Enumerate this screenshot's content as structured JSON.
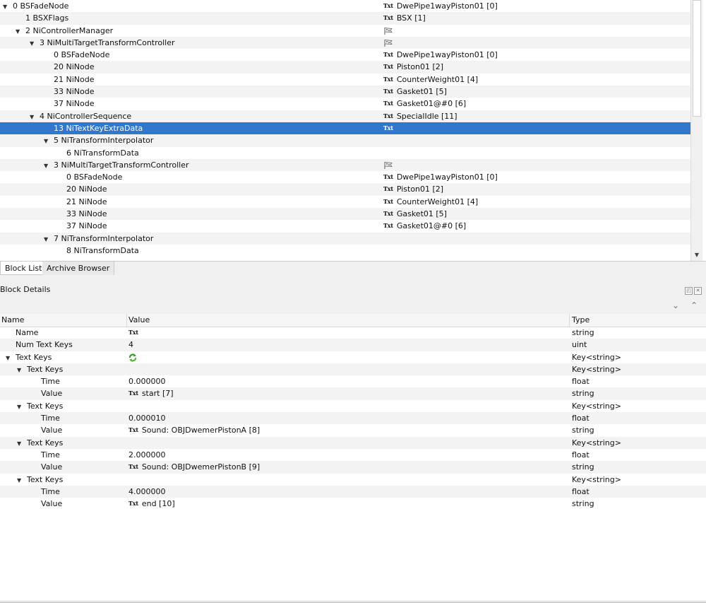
{
  "block_list": {
    "rows": [
      {
        "name": "0 BSFadeNode",
        "value": "DwePipe1wayPiston01 [0]",
        "value_icon": "txt",
        "expanded": true
      },
      {
        "name": "1 BSXFlags",
        "value": "BSX [1]",
        "value_icon": "txt"
      },
      {
        "name": "2 NiControllerManager",
        "value": "",
        "value_icon": "flag",
        "expanded": true
      },
      {
        "name": "3 NiMultiTargetTransformController",
        "value": "",
        "value_icon": "flag",
        "expanded": true
      },
      {
        "name": "0 BSFadeNode",
        "value": "DwePipe1wayPiston01 [0]",
        "value_icon": "txt"
      },
      {
        "name": "20 NiNode",
        "value": "Piston01 [2]",
        "value_icon": "txt"
      },
      {
        "name": "21 NiNode",
        "value": "CounterWeight01 [4]",
        "value_icon": "txt"
      },
      {
        "name": "33 NiNode",
        "value": "Gasket01 [5]",
        "value_icon": "txt"
      },
      {
        "name": "37 NiNode",
        "value": "Gasket01@#0 [6]",
        "value_icon": "txt"
      },
      {
        "name": "4 NiControllerSequence",
        "value": "SpecialIdle [11]",
        "value_icon": "txt",
        "expanded": true
      },
      {
        "name": "13 NiTextKeyExtraData",
        "value": "",
        "value_icon": "txt",
        "selected": true
      },
      {
        "name": "5 NiTransformInterpolator",
        "value": "",
        "value_icon": "",
        "expanded": true
      },
      {
        "name": "6 NiTransformData",
        "value": "",
        "value_icon": ""
      },
      {
        "name": "3 NiMultiTargetTransformController",
        "value": "",
        "value_icon": "flag",
        "expanded": true
      },
      {
        "name": "0 BSFadeNode",
        "value": "DwePipe1wayPiston01 [0]",
        "value_icon": "txt"
      },
      {
        "name": "20 NiNode",
        "value": "Piston01 [2]",
        "value_icon": "txt"
      },
      {
        "name": "21 NiNode",
        "value": "CounterWeight01 [4]",
        "value_icon": "txt"
      },
      {
        "name": "33 NiNode",
        "value": "Gasket01 [5]",
        "value_icon": "txt"
      },
      {
        "name": "37 NiNode",
        "value": "Gasket01@#0 [6]",
        "value_icon": "txt"
      },
      {
        "name": "7 NiTransformInterpolator",
        "value": "",
        "value_icon": "",
        "expanded": true
      },
      {
        "name": "8 NiTransformData",
        "value": "",
        "value_icon": ""
      }
    ],
    "expand_glyph": "▼",
    "scroll_down_glyph": "▼",
    "txt_badge": "Txt"
  },
  "tabs": [
    {
      "label": "Block List",
      "active": true
    },
    {
      "label": "Archive Browser",
      "active": false
    }
  ],
  "details": {
    "title": "Block Details",
    "dock_float_glyph": "◰",
    "dock_close_glyph": "✕",
    "expand_all_glyph": "⌄",
    "collapse_all_glyph": "⌃",
    "columns": {
      "name": "Name",
      "value": "Value",
      "type": "Type"
    },
    "rows": [
      {
        "name": "Name",
        "value": "",
        "value_icon": "txt",
        "type": "string"
      },
      {
        "name": "Num Text Keys",
        "value": "4",
        "value_icon": "",
        "type": "uint"
      },
      {
        "name": "Text Keys",
        "value": "",
        "value_icon": "refresh",
        "type": "Key<string>",
        "expanded": true
      },
      {
        "name": "Text Keys",
        "value": "",
        "value_icon": "",
        "type": "Key<string>",
        "expanded": true
      },
      {
        "name": "Time",
        "value": "0.000000",
        "value_icon": "",
        "type": "float"
      },
      {
        "name": "Value",
        "value": "start [7]",
        "value_icon": "txt",
        "type": "string"
      },
      {
        "name": "Text Keys",
        "value": "",
        "value_icon": "",
        "type": "Key<string>",
        "expanded": true
      },
      {
        "name": "Time",
        "value": "0.000010",
        "value_icon": "",
        "type": "float"
      },
      {
        "name": "Value",
        "value": "Sound: OBJDwemerPistonA [8]",
        "value_icon": "txt",
        "type": "string"
      },
      {
        "name": "Text Keys",
        "value": "",
        "value_icon": "",
        "type": "Key<string>",
        "expanded": true
      },
      {
        "name": "Time",
        "value": "2.000000",
        "value_icon": "",
        "type": "float"
      },
      {
        "name": "Value",
        "value": "Sound: OBJDwemerPistonB [9]",
        "value_icon": "txt",
        "type": "string"
      },
      {
        "name": "Text Keys",
        "value": "",
        "value_icon": "",
        "type": "Key<string>",
        "expanded": true
      },
      {
        "name": "Time",
        "value": "4.000000",
        "value_icon": "",
        "type": "float"
      },
      {
        "name": "Value",
        "value": "end [10]",
        "value_icon": "txt",
        "type": "string"
      }
    ]
  },
  "colors": {
    "selection": "#3178cc",
    "alt_row": "#f3f3f3",
    "panel_bg": "#f0f0f0"
  }
}
